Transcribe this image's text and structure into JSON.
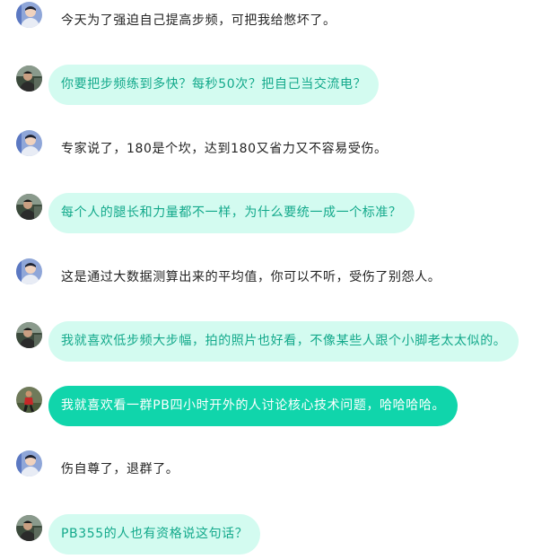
{
  "messages": [
    {
      "id": 1,
      "style": "plain",
      "avatar": "avatar-blue-person",
      "text": "今天为了强迫自己提高步频，可把我给憋坏了。"
    },
    {
      "id": 2,
      "style": "light",
      "avatar": "avatar-dark-person",
      "text": "你要把步频练到多快？每秒50次？把自己当交流电？"
    },
    {
      "id": 3,
      "style": "plain",
      "avatar": "avatar-blue-person",
      "text": "专家说了，180是个坎，达到180又省力又不容易受伤。"
    },
    {
      "id": 4,
      "style": "light",
      "avatar": "avatar-dark-person",
      "text": "每个人的腿长和力量都不一样，为什么要统一成一个标准？"
    },
    {
      "id": 5,
      "style": "plain",
      "avatar": "avatar-blue-person",
      "text": "这是通过大数据测算出来的平均值，你可以不听，受伤了别怨人。"
    },
    {
      "id": 6,
      "style": "light",
      "avatar": "avatar-dark-person",
      "text": "我就喜欢低步频大步幅，拍的照片也好看，不像某些人跟个小脚老太太似的。"
    },
    {
      "id": 7,
      "style": "solid",
      "avatar": "avatar-runner-person",
      "text": "我就喜欢看一群PB四小时开外的人讨论核心技术问题，哈哈哈哈。"
    },
    {
      "id": 8,
      "style": "plain",
      "avatar": "avatar-blue-person",
      "text": "伤自尊了，退群了。"
    },
    {
      "id": 9,
      "style": "light",
      "avatar": "avatar-dark-person",
      "text": "PB355的人也有资格说这句话？"
    }
  ],
  "colors": {
    "bubble_light_bg": "#d3fbf0",
    "bubble_light_text": "#13a98b",
    "bubble_solid_bg": "#10d5ab",
    "bubble_solid_text": "#ffffff",
    "plain_text": "#222222"
  }
}
